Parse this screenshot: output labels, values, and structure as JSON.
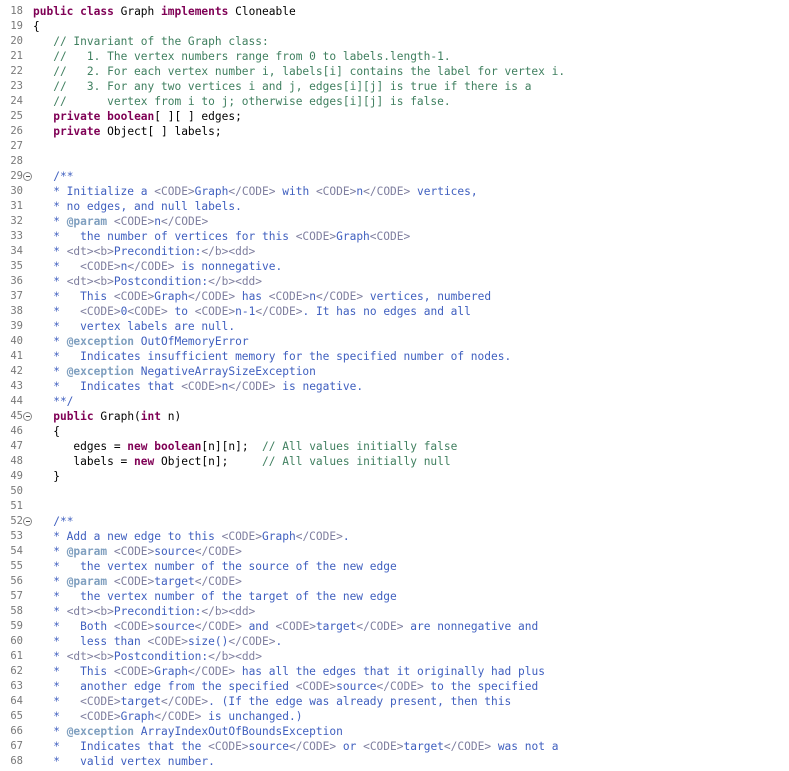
{
  "editor": {
    "colors": {
      "background": "#ffffff",
      "line_number": "#787878",
      "keyword": "#7f0055",
      "comment": "#3f7f5f",
      "javadoc": "#3f5fbf",
      "javadoc_tag": "#7f9fbf",
      "html_tag": "#7f7f9f"
    },
    "lines": [
      {
        "n": "18",
        "fold": false,
        "tokens": [
          {
            "t": "kw",
            "v": "public"
          },
          {
            "t": "",
            "v": " "
          },
          {
            "t": "kw",
            "v": "class"
          },
          {
            "t": "",
            "v": " Graph "
          },
          {
            "t": "kw",
            "v": "implements"
          },
          {
            "t": "",
            "v": " Cloneable"
          }
        ]
      },
      {
        "n": "19",
        "fold": false,
        "tokens": [
          {
            "t": "",
            "v": "{"
          }
        ]
      },
      {
        "n": "20",
        "fold": false,
        "tokens": [
          {
            "t": "",
            "v": "   "
          },
          {
            "t": "cm",
            "v": "// Invariant of the Graph class:"
          }
        ]
      },
      {
        "n": "21",
        "fold": false,
        "tokens": [
          {
            "t": "",
            "v": "   "
          },
          {
            "t": "cm",
            "v": "//   1. The vertex numbers range from 0 to labels.length-1."
          }
        ]
      },
      {
        "n": "22",
        "fold": false,
        "tokens": [
          {
            "t": "",
            "v": "   "
          },
          {
            "t": "cm",
            "v": "//   2. For each vertex number i, labels[i] contains the label for vertex i."
          }
        ]
      },
      {
        "n": "23",
        "fold": false,
        "tokens": [
          {
            "t": "",
            "v": "   "
          },
          {
            "t": "cm",
            "v": "//   3. For any two vertices i and j, edges[i][j] is true if there is a"
          }
        ]
      },
      {
        "n": "24",
        "fold": false,
        "tokens": [
          {
            "t": "",
            "v": "   "
          },
          {
            "t": "cm",
            "v": "//      vertex from i to j; otherwise edges[i][j] is false."
          }
        ]
      },
      {
        "n": "25",
        "fold": false,
        "tokens": [
          {
            "t": "",
            "v": "   "
          },
          {
            "t": "kw",
            "v": "private"
          },
          {
            "t": "",
            "v": " "
          },
          {
            "t": "kw",
            "v": "boolean"
          },
          {
            "t": "",
            "v": "[ ][ ] edges;"
          }
        ]
      },
      {
        "n": "26",
        "fold": false,
        "tokens": [
          {
            "t": "",
            "v": "   "
          },
          {
            "t": "kw",
            "v": "private"
          },
          {
            "t": "",
            "v": " Object[ ] labels;"
          }
        ]
      },
      {
        "n": "27",
        "fold": false,
        "tokens": []
      },
      {
        "n": "28",
        "fold": false,
        "tokens": []
      },
      {
        "n": "29",
        "fold": true,
        "tokens": [
          {
            "t": "",
            "v": "   "
          },
          {
            "t": "jd",
            "v": "/**"
          }
        ]
      },
      {
        "n": "30",
        "fold": false,
        "tokens": [
          {
            "t": "jd",
            "v": "   * Initialize a "
          },
          {
            "t": "tag",
            "v": "<CODE>"
          },
          {
            "t": "jd",
            "v": "Graph"
          },
          {
            "t": "tag",
            "v": "</CODE>"
          },
          {
            "t": "jd",
            "v": " with "
          },
          {
            "t": "tag",
            "v": "<CODE>"
          },
          {
            "t": "jd",
            "v": "n"
          },
          {
            "t": "tag",
            "v": "</CODE>"
          },
          {
            "t": "jd",
            "v": " vertices,"
          }
        ]
      },
      {
        "n": "31",
        "fold": false,
        "tokens": [
          {
            "t": "jd",
            "v": "   * no edges, and null labels."
          }
        ]
      },
      {
        "n": "32",
        "fold": false,
        "tokens": [
          {
            "t": "jd",
            "v": "   * "
          },
          {
            "t": "at",
            "v": "@param"
          },
          {
            "t": "jd",
            "v": " "
          },
          {
            "t": "tag",
            "v": "<CODE>"
          },
          {
            "t": "jd",
            "v": "n"
          },
          {
            "t": "tag",
            "v": "</CODE>"
          }
        ]
      },
      {
        "n": "33",
        "fold": false,
        "tokens": [
          {
            "t": "jd",
            "v": "   *   the number of vertices for this "
          },
          {
            "t": "tag",
            "v": "<CODE>"
          },
          {
            "t": "jd",
            "v": "Graph"
          },
          {
            "t": "tag",
            "v": "<CODE>"
          }
        ]
      },
      {
        "n": "34",
        "fold": false,
        "tokens": [
          {
            "t": "jd",
            "v": "   * "
          },
          {
            "t": "tag",
            "v": "<dt><b>"
          },
          {
            "t": "jd",
            "v": "Precondition:"
          },
          {
            "t": "tag",
            "v": "</b><dd>"
          }
        ]
      },
      {
        "n": "35",
        "fold": false,
        "tokens": [
          {
            "t": "jd",
            "v": "   *   "
          },
          {
            "t": "tag",
            "v": "<CODE>"
          },
          {
            "t": "jd",
            "v": "n"
          },
          {
            "t": "tag",
            "v": "</CODE>"
          },
          {
            "t": "jd",
            "v": " is nonnegative."
          }
        ]
      },
      {
        "n": "36",
        "fold": false,
        "tokens": [
          {
            "t": "jd",
            "v": "   * "
          },
          {
            "t": "tag",
            "v": "<dt><b>"
          },
          {
            "t": "jd",
            "v": "Postcondition:"
          },
          {
            "t": "tag",
            "v": "</b><dd>"
          }
        ]
      },
      {
        "n": "37",
        "fold": false,
        "tokens": [
          {
            "t": "jd",
            "v": "   *   This "
          },
          {
            "t": "tag",
            "v": "<CODE>"
          },
          {
            "t": "jd",
            "v": "Graph"
          },
          {
            "t": "tag",
            "v": "</CODE>"
          },
          {
            "t": "jd",
            "v": " has "
          },
          {
            "t": "tag",
            "v": "<CODE>"
          },
          {
            "t": "jd",
            "v": "n"
          },
          {
            "t": "tag",
            "v": "</CODE>"
          },
          {
            "t": "jd",
            "v": " vertices, numbered"
          }
        ]
      },
      {
        "n": "38",
        "fold": false,
        "tokens": [
          {
            "t": "jd",
            "v": "   *   "
          },
          {
            "t": "tag",
            "v": "<CODE>"
          },
          {
            "t": "jd",
            "v": "0"
          },
          {
            "t": "tag",
            "v": "<CODE>"
          },
          {
            "t": "jd",
            "v": " to "
          },
          {
            "t": "tag",
            "v": "<CODE>"
          },
          {
            "t": "jd",
            "v": "n-1"
          },
          {
            "t": "tag",
            "v": "</CODE>"
          },
          {
            "t": "jd",
            "v": ". It has no edges and all"
          }
        ]
      },
      {
        "n": "39",
        "fold": false,
        "tokens": [
          {
            "t": "jd",
            "v": "   *   vertex labels are null."
          }
        ]
      },
      {
        "n": "40",
        "fold": false,
        "tokens": [
          {
            "t": "jd",
            "v": "   * "
          },
          {
            "t": "at",
            "v": "@exception"
          },
          {
            "t": "jd",
            "v": " OutOfMemoryError"
          }
        ]
      },
      {
        "n": "41",
        "fold": false,
        "tokens": [
          {
            "t": "jd",
            "v": "   *   Indicates insufficient memory for the specified number of nodes."
          }
        ]
      },
      {
        "n": "42",
        "fold": false,
        "tokens": [
          {
            "t": "jd",
            "v": "   * "
          },
          {
            "t": "at",
            "v": "@exception"
          },
          {
            "t": "jd",
            "v": " NegativeArraySizeException"
          }
        ]
      },
      {
        "n": "43",
        "fold": false,
        "tokens": [
          {
            "t": "jd",
            "v": "   *   Indicates that "
          },
          {
            "t": "tag",
            "v": "<CODE>"
          },
          {
            "t": "jd",
            "v": "n"
          },
          {
            "t": "tag",
            "v": "</CODE>"
          },
          {
            "t": "jd",
            "v": " is negative."
          }
        ]
      },
      {
        "n": "44",
        "fold": false,
        "tokens": [
          {
            "t": "jd",
            "v": "   **/"
          }
        ]
      },
      {
        "n": "45",
        "fold": true,
        "tokens": [
          {
            "t": "",
            "v": "   "
          },
          {
            "t": "kw",
            "v": "public"
          },
          {
            "t": "",
            "v": " Graph("
          },
          {
            "t": "kw",
            "v": "int"
          },
          {
            "t": "",
            "v": " n)"
          }
        ]
      },
      {
        "n": "46",
        "fold": false,
        "tokens": [
          {
            "t": "",
            "v": "   {"
          }
        ]
      },
      {
        "n": "47",
        "fold": false,
        "tokens": [
          {
            "t": "",
            "v": "      edges = "
          },
          {
            "t": "kw",
            "v": "new"
          },
          {
            "t": "",
            "v": " "
          },
          {
            "t": "kw",
            "v": "boolean"
          },
          {
            "t": "",
            "v": "[n][n];  "
          },
          {
            "t": "cm",
            "v": "// All values initially false"
          }
        ]
      },
      {
        "n": "48",
        "fold": false,
        "tokens": [
          {
            "t": "",
            "v": "      labels = "
          },
          {
            "t": "kw",
            "v": "new"
          },
          {
            "t": "",
            "v": " Object[n];     "
          },
          {
            "t": "cm",
            "v": "// All values initially null"
          }
        ]
      },
      {
        "n": "49",
        "fold": false,
        "tokens": [
          {
            "t": "",
            "v": "   }"
          }
        ]
      },
      {
        "n": "50",
        "fold": false,
        "tokens": []
      },
      {
        "n": "51",
        "fold": false,
        "tokens": []
      },
      {
        "n": "52",
        "fold": true,
        "tokens": [
          {
            "t": "",
            "v": "   "
          },
          {
            "t": "jd",
            "v": "/**"
          }
        ]
      },
      {
        "n": "53",
        "fold": false,
        "tokens": [
          {
            "t": "jd",
            "v": "   * Add a new edge to this "
          },
          {
            "t": "tag",
            "v": "<CODE>"
          },
          {
            "t": "jd",
            "v": "Graph"
          },
          {
            "t": "tag",
            "v": "</CODE>"
          },
          {
            "t": "jd",
            "v": "."
          }
        ]
      },
      {
        "n": "54",
        "fold": false,
        "tokens": [
          {
            "t": "jd",
            "v": "   * "
          },
          {
            "t": "at",
            "v": "@param"
          },
          {
            "t": "jd",
            "v": " "
          },
          {
            "t": "tag",
            "v": "<CODE>"
          },
          {
            "t": "jd",
            "v": "source"
          },
          {
            "t": "tag",
            "v": "</CODE>"
          }
        ]
      },
      {
        "n": "55",
        "fold": false,
        "tokens": [
          {
            "t": "jd",
            "v": "   *   the vertex number of the source of the new edge"
          }
        ]
      },
      {
        "n": "56",
        "fold": false,
        "tokens": [
          {
            "t": "jd",
            "v": "   * "
          },
          {
            "t": "at",
            "v": "@param"
          },
          {
            "t": "jd",
            "v": " "
          },
          {
            "t": "tag",
            "v": "<CODE>"
          },
          {
            "t": "jd",
            "v": "target"
          },
          {
            "t": "tag",
            "v": "</CODE>"
          }
        ]
      },
      {
        "n": "57",
        "fold": false,
        "tokens": [
          {
            "t": "jd",
            "v": "   *   the vertex number of the target of the new edge"
          }
        ]
      },
      {
        "n": "58",
        "fold": false,
        "tokens": [
          {
            "t": "jd",
            "v": "   * "
          },
          {
            "t": "tag",
            "v": "<dt><b>"
          },
          {
            "t": "jd",
            "v": "Precondition:"
          },
          {
            "t": "tag",
            "v": "</b><dd>"
          }
        ]
      },
      {
        "n": "59",
        "fold": false,
        "tokens": [
          {
            "t": "jd",
            "v": "   *   Both "
          },
          {
            "t": "tag",
            "v": "<CODE>"
          },
          {
            "t": "jd",
            "v": "source"
          },
          {
            "t": "tag",
            "v": "</CODE>"
          },
          {
            "t": "jd",
            "v": " and "
          },
          {
            "t": "tag",
            "v": "<CODE>"
          },
          {
            "t": "jd",
            "v": "target"
          },
          {
            "t": "tag",
            "v": "</CODE>"
          },
          {
            "t": "jd",
            "v": " are nonnegative and"
          }
        ]
      },
      {
        "n": "60",
        "fold": false,
        "tokens": [
          {
            "t": "jd",
            "v": "   *   less than "
          },
          {
            "t": "tag",
            "v": "<CODE>"
          },
          {
            "t": "jd",
            "v": "size()"
          },
          {
            "t": "tag",
            "v": "</CODE>"
          },
          {
            "t": "jd",
            "v": "."
          }
        ]
      },
      {
        "n": "61",
        "fold": false,
        "tokens": [
          {
            "t": "jd",
            "v": "   * "
          },
          {
            "t": "tag",
            "v": "<dt><b>"
          },
          {
            "t": "jd",
            "v": "Postcondition:"
          },
          {
            "t": "tag",
            "v": "</b><dd>"
          }
        ]
      },
      {
        "n": "62",
        "fold": false,
        "tokens": [
          {
            "t": "jd",
            "v": "   *   This "
          },
          {
            "t": "tag",
            "v": "<CODE>"
          },
          {
            "t": "jd",
            "v": "Graph"
          },
          {
            "t": "tag",
            "v": "</CODE>"
          },
          {
            "t": "jd",
            "v": " has all the edges that it originally had plus"
          }
        ]
      },
      {
        "n": "63",
        "fold": false,
        "tokens": [
          {
            "t": "jd",
            "v": "   *   another edge from the specified "
          },
          {
            "t": "tag",
            "v": "<CODE>"
          },
          {
            "t": "jd",
            "v": "source"
          },
          {
            "t": "tag",
            "v": "</CODE>"
          },
          {
            "t": "jd",
            "v": " to the specified"
          }
        ]
      },
      {
        "n": "64",
        "fold": false,
        "tokens": [
          {
            "t": "jd",
            "v": "   *   "
          },
          {
            "t": "tag",
            "v": "<CODE>"
          },
          {
            "t": "jd",
            "v": "target"
          },
          {
            "t": "tag",
            "v": "</CODE>"
          },
          {
            "t": "jd",
            "v": ". (If the edge was already present, then this"
          }
        ]
      },
      {
        "n": "65",
        "fold": false,
        "tokens": [
          {
            "t": "jd",
            "v": "   *   "
          },
          {
            "t": "tag",
            "v": "<CODE>"
          },
          {
            "t": "jd",
            "v": "Graph"
          },
          {
            "t": "tag",
            "v": "</CODE>"
          },
          {
            "t": "jd",
            "v": " is unchanged.)"
          }
        ]
      },
      {
        "n": "66",
        "fold": false,
        "tokens": [
          {
            "t": "jd",
            "v": "   * "
          },
          {
            "t": "at",
            "v": "@exception"
          },
          {
            "t": "jd",
            "v": " ArrayIndexOutOfBoundsException"
          }
        ]
      },
      {
        "n": "67",
        "fold": false,
        "tokens": [
          {
            "t": "jd",
            "v": "   *   Indicates that the "
          },
          {
            "t": "tag",
            "v": "<CODE>"
          },
          {
            "t": "jd",
            "v": "source"
          },
          {
            "t": "tag",
            "v": "</CODE>"
          },
          {
            "t": "jd",
            "v": " or "
          },
          {
            "t": "tag",
            "v": "<CODE>"
          },
          {
            "t": "jd",
            "v": "target"
          },
          {
            "t": "tag",
            "v": "</CODE>"
          },
          {
            "t": "jd",
            "v": " was not a"
          }
        ]
      },
      {
        "n": "68",
        "fold": false,
        "tokens": [
          {
            "t": "jd",
            "v": "   *   valid vertex number."
          }
        ]
      }
    ]
  }
}
